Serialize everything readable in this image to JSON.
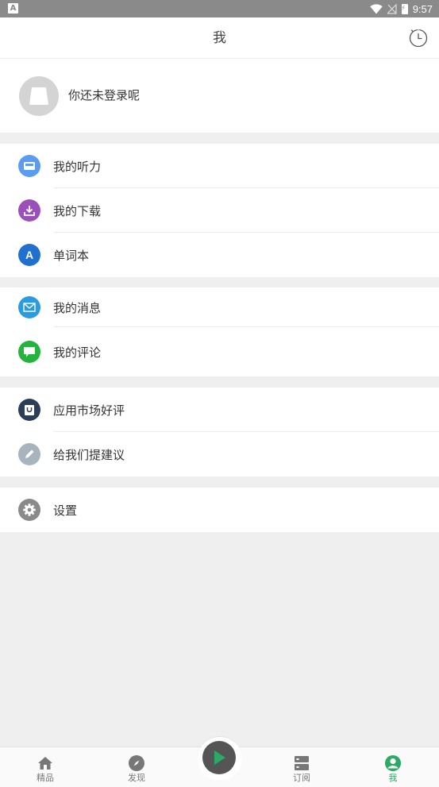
{
  "status_bar": {
    "app_icon_letter": "A",
    "time": "9:57",
    "battery_glyph": "⚡"
  },
  "header": {
    "title": "我",
    "history_icon": "timer-icon"
  },
  "profile": {
    "login_text": "你还未登录呢",
    "avatar_icon": "default-avatar-icon"
  },
  "menu_groups": [
    [
      {
        "label": "我的听力",
        "icon": "inbox-icon",
        "color": "#5b9cf0"
      },
      {
        "label": "我的下载",
        "icon": "download-icon",
        "color": "#9b4fb8"
      },
      {
        "label": "单词本",
        "icon": "letter-a-icon",
        "color": "#2170d0",
        "glyph": "A"
      }
    ],
    [
      {
        "label": "我的消息",
        "icon": "mail-icon",
        "color": "#2a9be0"
      },
      {
        "label": "我的评论",
        "icon": "chat-icon",
        "color": "#24b33c"
      }
    ],
    [
      {
        "label": "应用市场好评",
        "icon": "market-icon",
        "color": "#2b3d57"
      },
      {
        "label": "给我们提建议",
        "icon": "pencil-icon",
        "color": "#a8b4bd"
      }
    ],
    [
      {
        "label": "设置",
        "icon": "gear-icon",
        "color": "#8a8a8a"
      }
    ]
  ],
  "tabs": [
    {
      "label": "精品",
      "icon": "home-icon"
    },
    {
      "label": "发现",
      "icon": "compass-icon"
    },
    {
      "label": "订阅",
      "icon": "subscription-icon"
    },
    {
      "label": "我",
      "icon": "user-icon",
      "active_color": "#2aaa64"
    }
  ],
  "player": {
    "icon": "play-icon",
    "accent": "#2aaa64"
  }
}
